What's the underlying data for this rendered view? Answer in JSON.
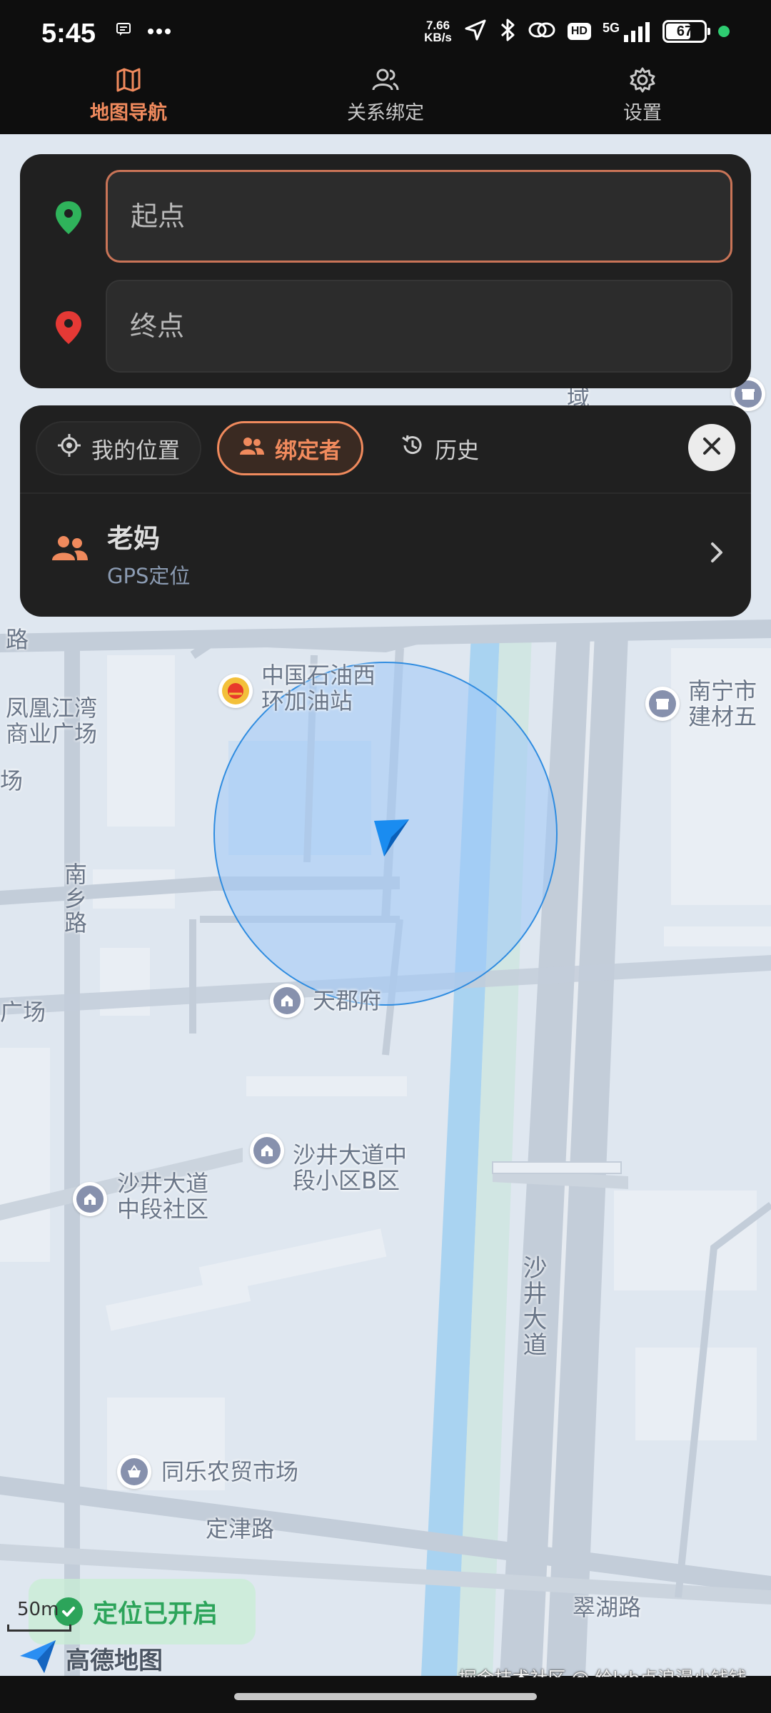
{
  "status_bar": {
    "time": "5:45",
    "net_speed_value": "7.66",
    "net_speed_unit": "KB/s",
    "hd": "HD",
    "signal": "5G",
    "battery": "67",
    "battery_level_percent": 67
  },
  "tabs": [
    {
      "label": "地图导航",
      "icon": "map-icon",
      "active": true
    },
    {
      "label": "关系绑定",
      "icon": "users-icon",
      "active": false
    },
    {
      "label": "设置",
      "icon": "gear-icon",
      "active": false
    }
  ],
  "route": {
    "start_placeholder": "起点",
    "end_placeholder": "终点"
  },
  "bind_panel": {
    "chips": [
      {
        "label": "我的位置",
        "icon": "locate-icon"
      },
      {
        "label": "绑定者",
        "icon": "group-icon"
      },
      {
        "label": "历史",
        "icon": "history-icon"
      }
    ],
    "contact": {
      "name": "老妈",
      "subtitle": "GPS定位"
    }
  },
  "map": {
    "labels": {
      "road_top_left": "路",
      "fenghuang": "凤凰江湾\n商业广场",
      "field_left": "场",
      "nanxiang": "南乡路",
      "guangchang": "广场",
      "sinopec": "中国石油西\n环加油站",
      "nanning": "南宁市\n建材五",
      "tianjunfu": "天郡府",
      "shajing_b": "沙井大道中\n段小区B区",
      "shajing_community": "沙井大道\n中段社区",
      "shajing_road": "沙井大道",
      "tongle": "同乐农贸市场",
      "dingjin": "定津路",
      "cuihu": "翠湖路",
      "partial_top": "域"
    },
    "colors": {
      "background": "#dfe7f0",
      "road": "#c3cdd9",
      "river": "#a9d3f1",
      "accuracy_circle": "#9ec9f7",
      "accent": "#f08a5d"
    }
  },
  "location_toast": "定位已开启",
  "scale_label": "50m",
  "amap_brand": "高德地图",
  "watermark": "掘金技术社区 @ 给lxb点浪漫小钱钱"
}
